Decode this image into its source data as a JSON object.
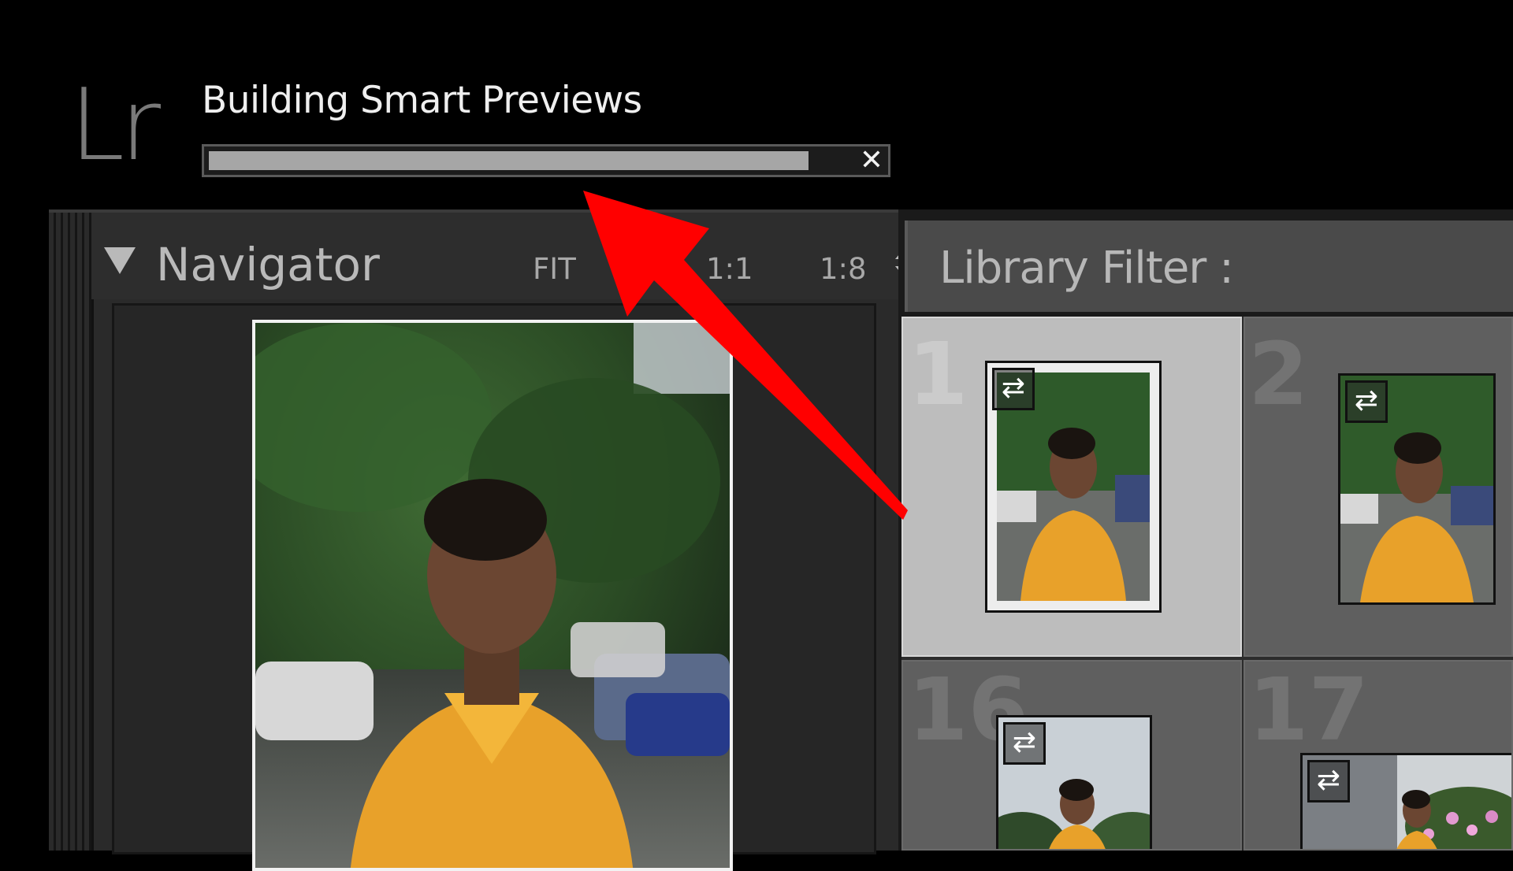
{
  "header": {
    "app_logo": "Lr",
    "progress_title": "Building Smart Previews",
    "progress_fraction": 0.93,
    "cancel_icon": "✕"
  },
  "navigator": {
    "title": "Navigator",
    "zoom_options": [
      "FIT",
      "FI",
      "1:1",
      "1:8"
    ]
  },
  "library": {
    "filter_label": "Library Filter :",
    "cells": [
      {
        "number": "1",
        "selected": true,
        "badge": "⇄"
      },
      {
        "number": "2",
        "selected": false,
        "badge": "⇄"
      },
      {
        "number": "16",
        "selected": false,
        "badge": "⇄"
      },
      {
        "number": "17",
        "selected": false,
        "badge": "⇄"
      }
    ]
  },
  "colors": {
    "annotation_arrow": "#ff0000",
    "shirt": "#e8a12a",
    "selected_cell": "#bdbdbd"
  }
}
